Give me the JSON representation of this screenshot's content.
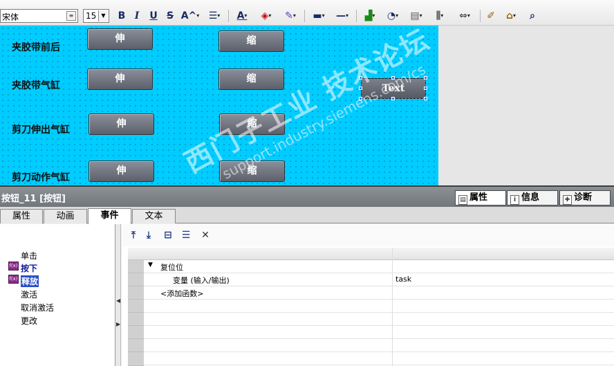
{
  "toolbar": {
    "font_name": "宋体",
    "font_size": "15",
    "bold": "B",
    "italic": "I",
    "underline": "U",
    "strike": "S",
    "superscript": "A^",
    "font_color": "A"
  },
  "canvas": {
    "labels": [
      "夹胶带前后",
      "夹胶带气缸",
      "剪刀伸出气缸",
      "剪刀动作气缸"
    ],
    "extend_label": "伸",
    "retract_label": "缩",
    "text_button": "Text",
    "background": "#00ccff"
  },
  "inspector": {
    "title": "按钮_11 [按钮]",
    "tabs": [
      {
        "label": "属性",
        "icon": "properties-icon"
      },
      {
        "label": "信息",
        "icon": "info-icon"
      },
      {
        "label": "诊断",
        "icon": "diagnostics-icon"
      }
    ],
    "subtabs": [
      "属性",
      "动画",
      "事件",
      "文本"
    ]
  },
  "events": [
    "单击",
    "按下",
    "释放",
    "激活",
    "取消激活",
    "更改"
  ],
  "grid": {
    "function_name": "复位位",
    "param_name": "变量 (输入/输出)",
    "param_value": "task",
    "add_function": "<添加函数>"
  },
  "watermark": {
    "text": "西门子工业 技术论坛",
    "url": "support.industry.siemens.com/cs"
  }
}
